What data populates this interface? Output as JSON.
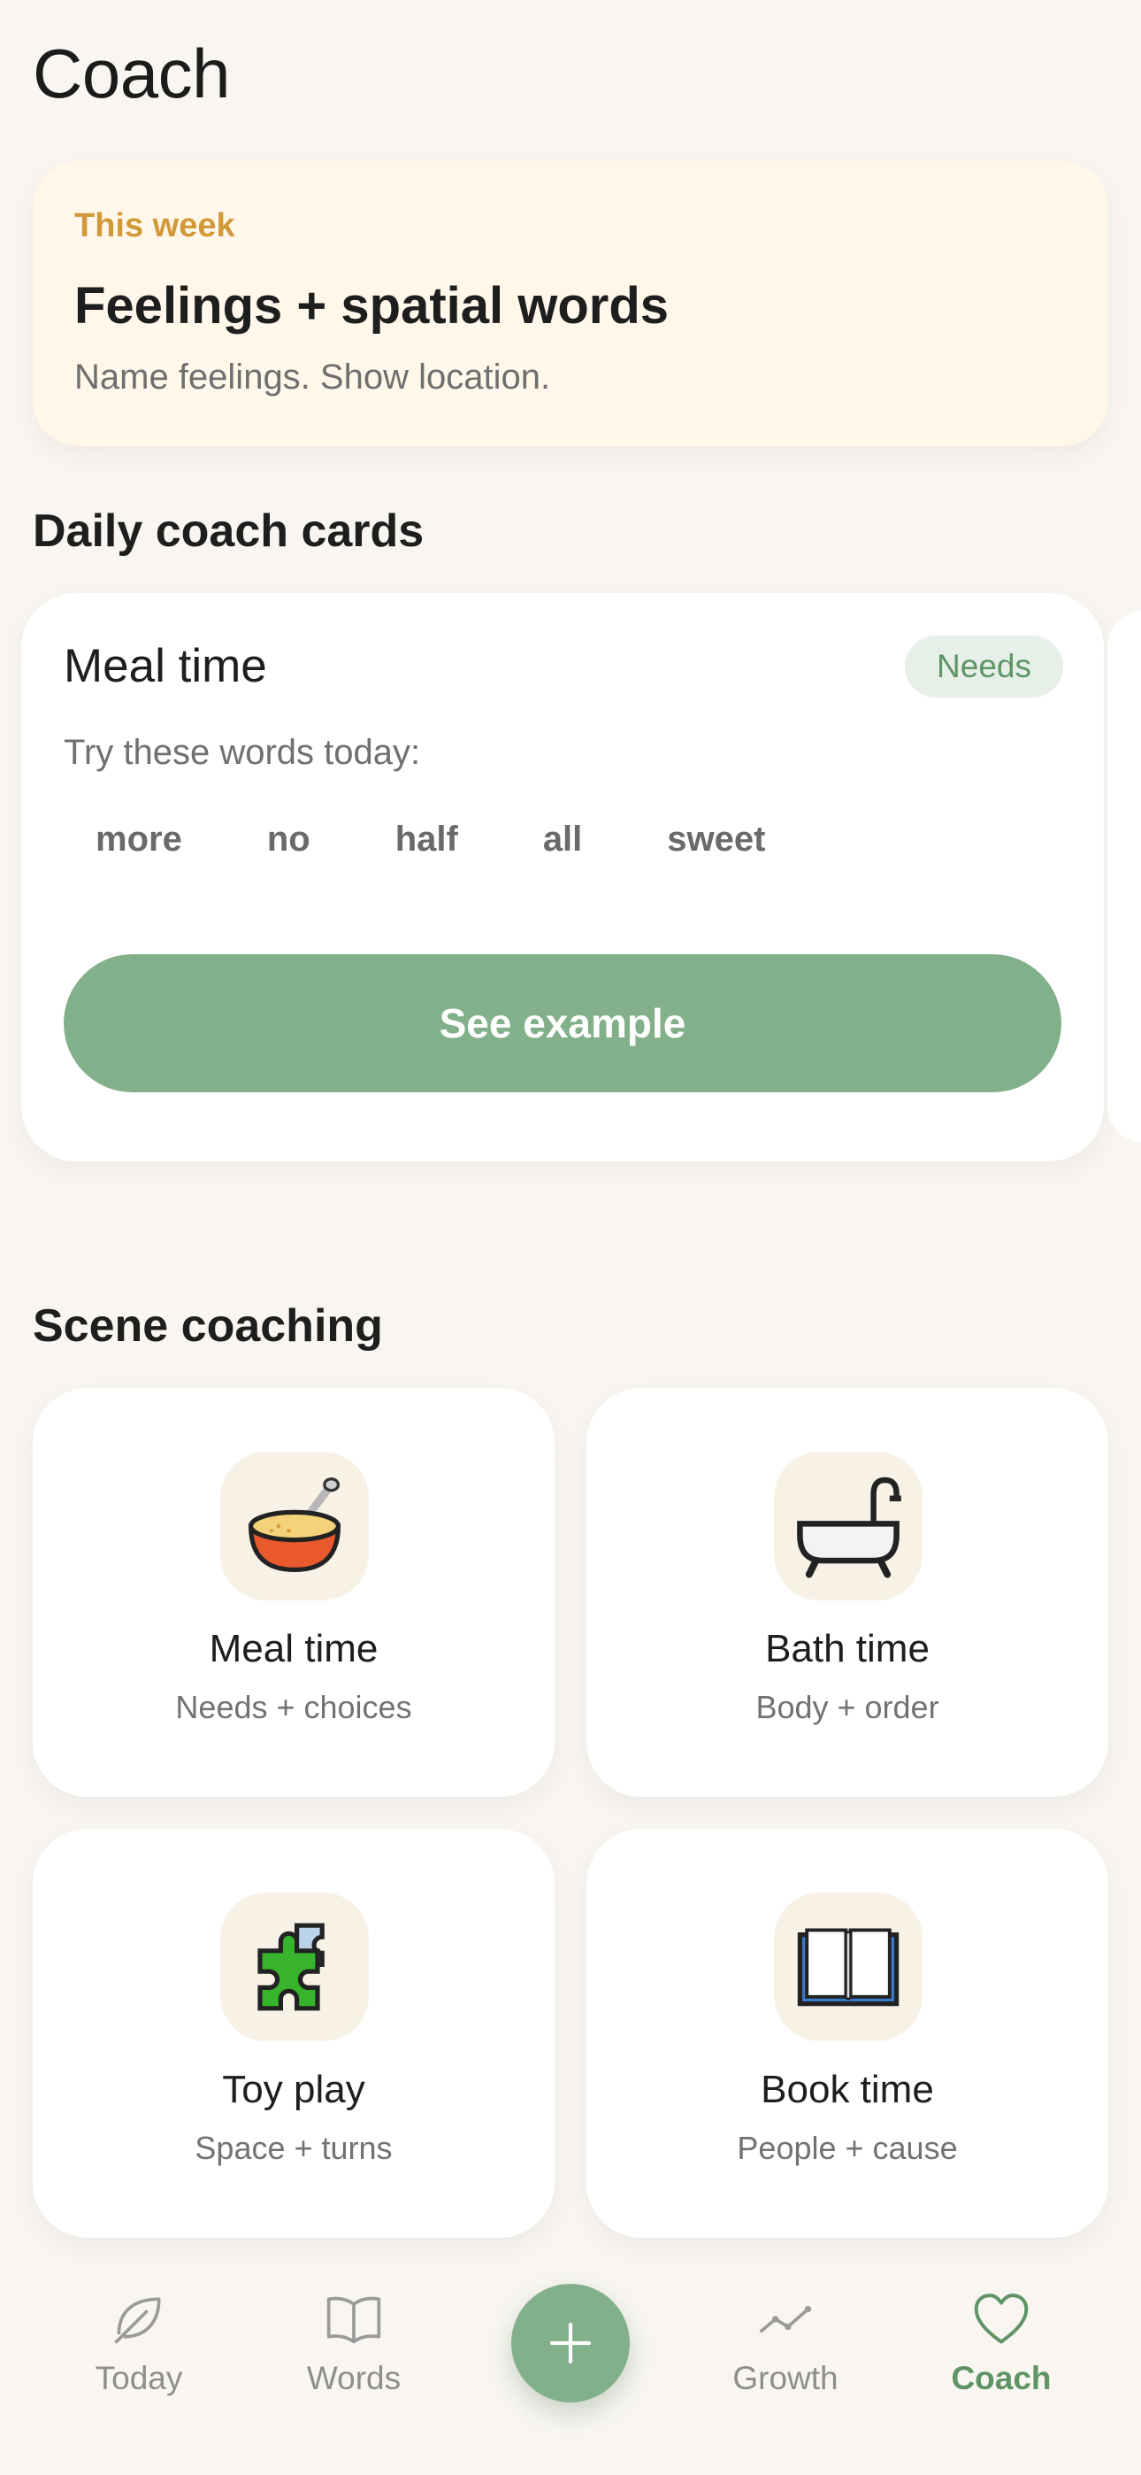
{
  "header": {
    "title": "Coach"
  },
  "weekly_focus": {
    "kicker": "This week",
    "title": "Feelings + spatial words",
    "subtitle": "Name feelings. Show location."
  },
  "daily_section": {
    "title": "Daily coach cards"
  },
  "coach_card": {
    "title": "Meal time",
    "badge": "Needs",
    "prompt": "Try these words today:",
    "words": [
      "more",
      "no",
      "half",
      "all",
      "sweet"
    ],
    "button_label": "See example"
  },
  "scene_section": {
    "title": "Scene coaching"
  },
  "scenes": [
    {
      "title": "Meal time",
      "subtitle": "Needs + choices",
      "icon": "bowl-icon"
    },
    {
      "title": "Bath time",
      "subtitle": "Body + order",
      "icon": "bathtub-icon"
    },
    {
      "title": "Toy play",
      "subtitle": "Space + turns",
      "icon": "puzzle-icon"
    },
    {
      "title": "Book time",
      "subtitle": "People + cause",
      "icon": "open-book-icon"
    }
  ],
  "nav": {
    "items": [
      {
        "label": "Today",
        "icon": "leaf-icon"
      },
      {
        "label": "Words",
        "icon": "book-icon"
      },
      {
        "label": "Growth",
        "icon": "trend-icon"
      },
      {
        "label": "Coach",
        "icon": "heart-icon",
        "active": true
      }
    ],
    "fab_icon": "plus-icon"
  },
  "colors": {
    "background": "#f9f6f1",
    "accent_green": "#82b08a",
    "active_green": "#5e9466",
    "week_card_bg": "#fff8ea",
    "week_kicker": "#d2993a"
  }
}
